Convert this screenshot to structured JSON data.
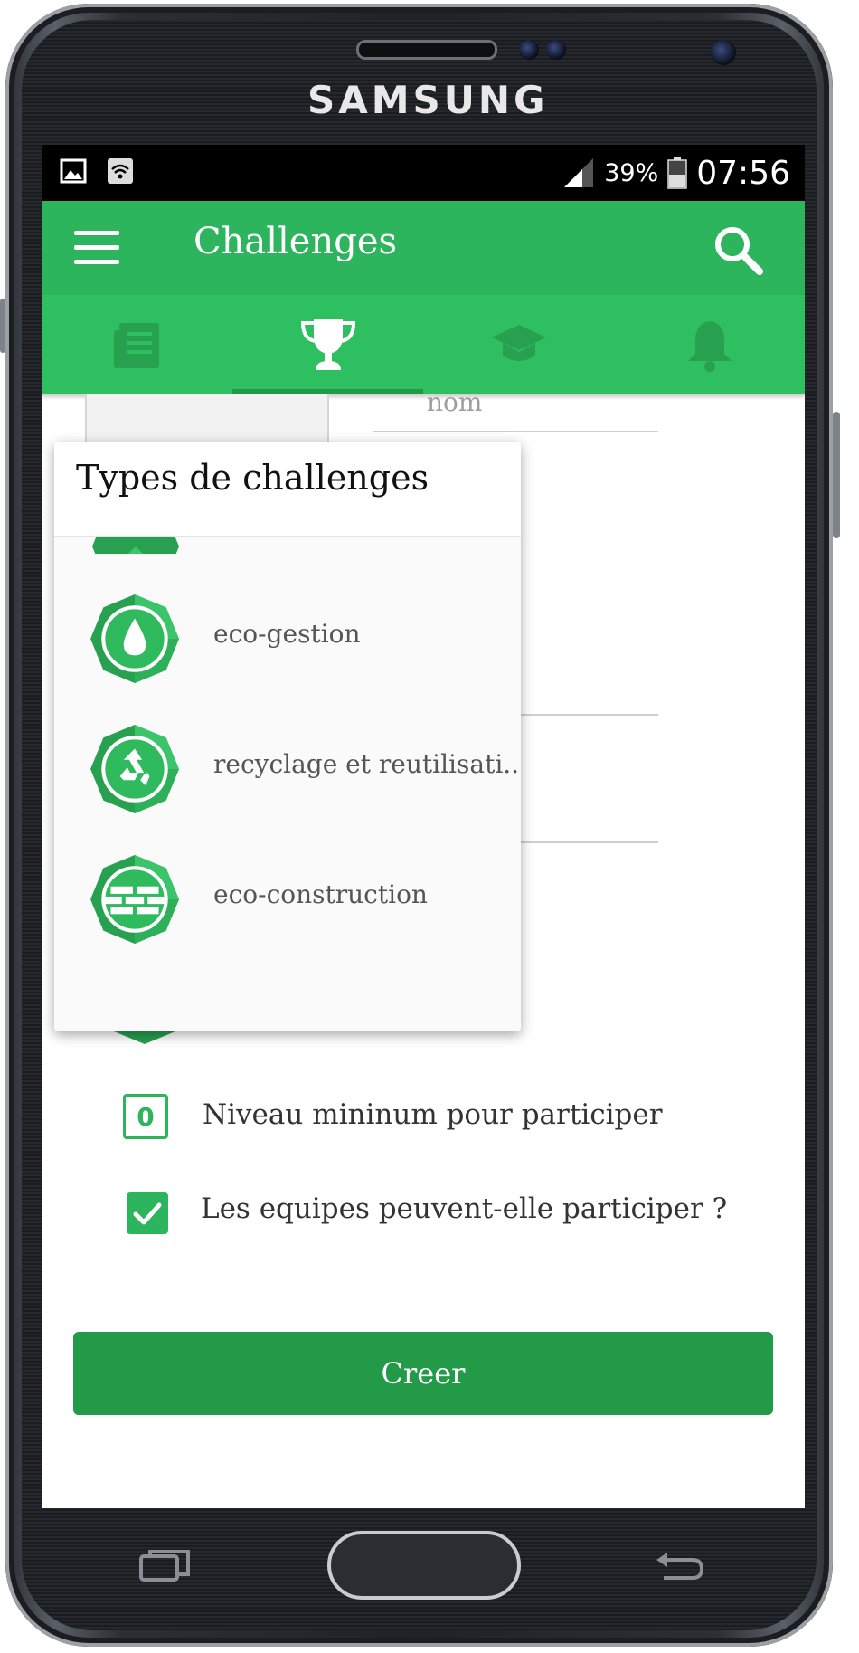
{
  "device": {
    "brand": "SAMSUNG"
  },
  "status_bar": {
    "battery_percent": "39%",
    "time": "07:56"
  },
  "app_bar": {
    "title": "Challenges"
  },
  "tabs": [
    {
      "icon": "newspaper-icon",
      "selected": false
    },
    {
      "icon": "trophy-icon",
      "selected": true
    },
    {
      "icon": "graduation-cap-icon",
      "selected": false
    },
    {
      "icon": "bell-icon",
      "selected": false
    }
  ],
  "form": {
    "name_label": "nom",
    "level_value": "0",
    "level_label": "Niveau mininum pour participer",
    "teams_label": "Les equipes peuvent-elle participer ?",
    "teams_checked": true,
    "create_button": "Creer"
  },
  "popup": {
    "title": "Types de challenges",
    "options": [
      {
        "label": "eco-gestion",
        "icon": "water-drop-icon"
      },
      {
        "label": "recyclage et reutilisati...",
        "icon": "recycle-icon"
      },
      {
        "label": "eco-construction",
        "icon": "brick-wall-icon"
      }
    ]
  },
  "colors": {
    "primary": "#2db55d",
    "tab_bar": "#2ebf60",
    "button": "#239a48",
    "badge_dark": "#27a04f",
    "badge_light": "#3cc46a"
  }
}
